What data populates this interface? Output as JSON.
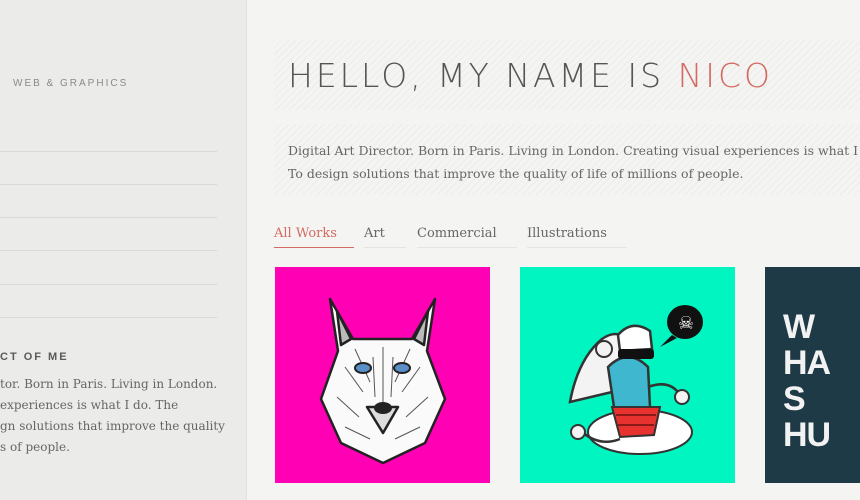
{
  "sidebar": {
    "tagline": "WEB & GRAPHICS",
    "about_heading": "CT OF ME",
    "about_lines": [
      "tor. Born in Paris. Living in London.",
      "experiences is what I do. The",
      "gn solutions that improve the quality",
      "s of people."
    ]
  },
  "hero": {
    "greeting": "HELLO, MY NAME IS ",
    "name": "NICO"
  },
  "bio": {
    "line1": "Digital Art Director. Born in Paris. Living in London. Creating visual experiences is what I d",
    "line2": "To design solutions that improve the quality of life of millions of people."
  },
  "filters": [
    {
      "label": "All Works",
      "active": true
    },
    {
      "label": "Art",
      "active": false
    },
    {
      "label": "Commercial",
      "active": false
    },
    {
      "label": "Illustrations",
      "active": false
    }
  ],
  "portfolio": [
    {
      "icon": "wolf-illustration",
      "color": "#ff00b4"
    },
    {
      "icon": "pirate-character-illustration",
      "color": "#00f5c0"
    },
    {
      "icon": "typography-poster",
      "color": "#1f3a47",
      "lines": [
        "W",
        "HA",
        "S",
        "HU"
      ]
    }
  ],
  "colors": {
    "accent": "#d46a62"
  }
}
